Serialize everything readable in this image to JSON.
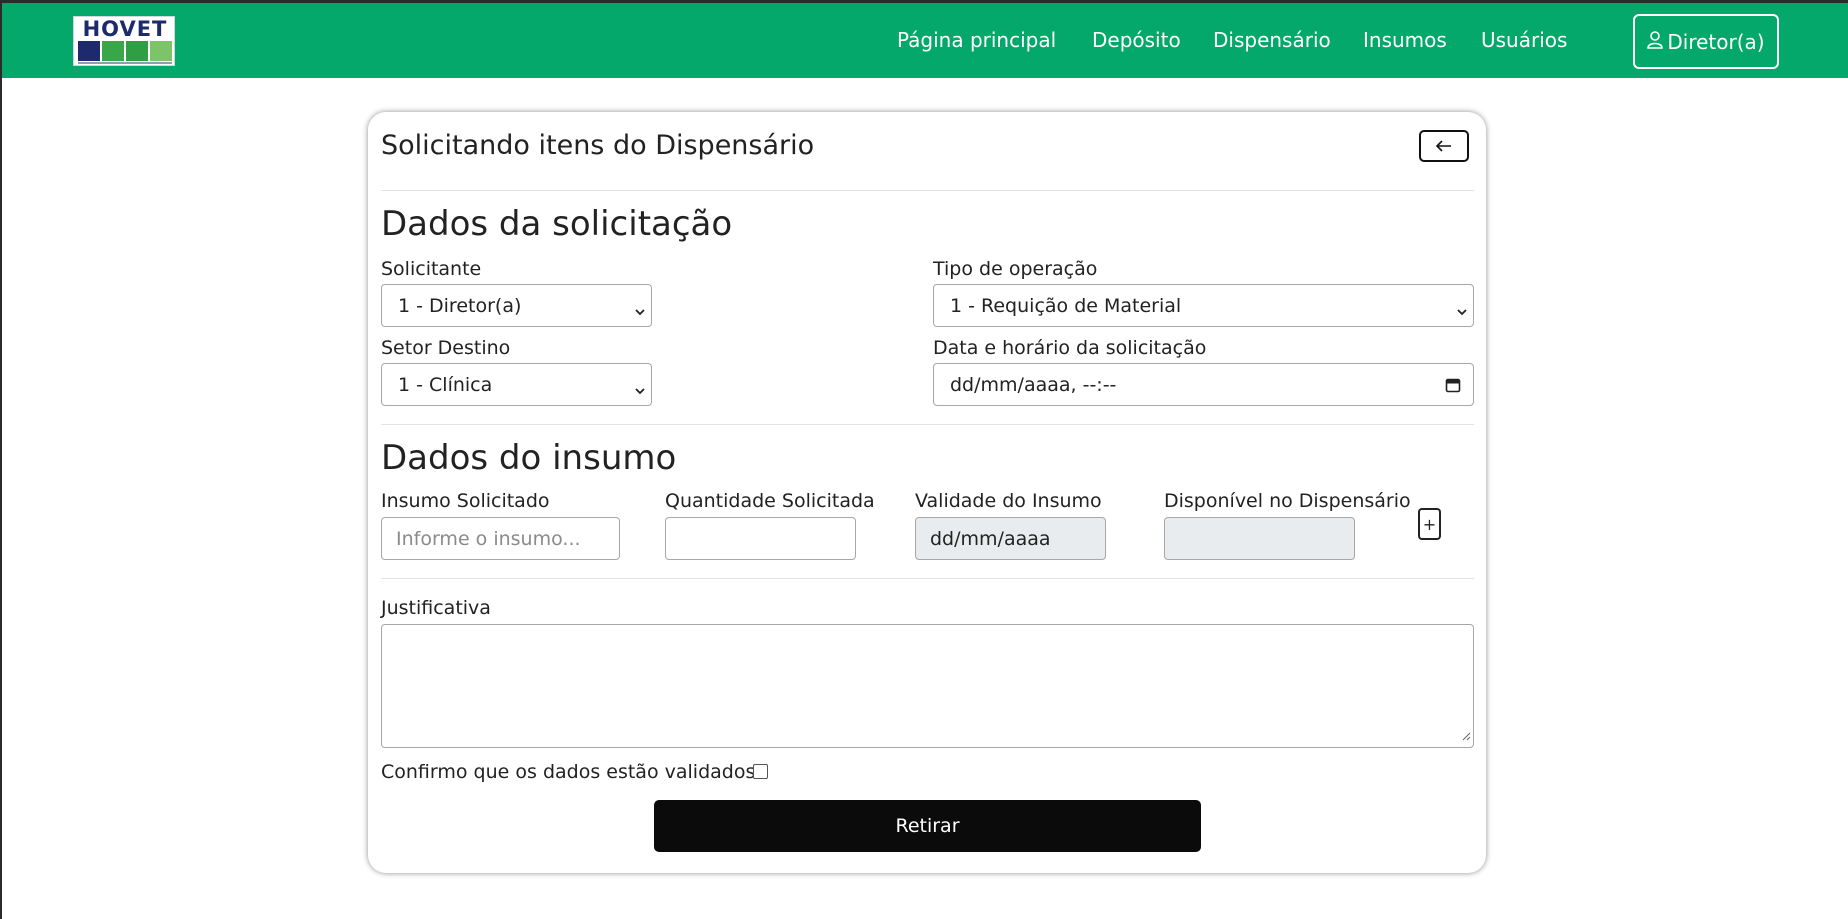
{
  "brand": {
    "name": "HOVET"
  },
  "nav": {
    "links": [
      "Página principal",
      "Depósito",
      "Dispensário",
      "Insumos",
      "Usuários"
    ],
    "user_label": "Diretor(a)"
  },
  "card": {
    "title": "Solicitando itens do Dispensário",
    "section_request": "Dados da solicitação",
    "solicitante": {
      "label": "Solicitante",
      "value": "1 - Diretor(a)"
    },
    "tipo_operacao": {
      "label": "Tipo de operação",
      "value": "1 - Requição de Material"
    },
    "setor_destino": {
      "label": "Setor Destino",
      "value": "1 - Clínica"
    },
    "data_horario": {
      "label": "Data e horário da solicitação",
      "value": "dd/mm/aaaa, --:--"
    },
    "section_item": "Dados do insumo",
    "insumo": {
      "label": "Insumo Solicitado",
      "placeholder": "Informe o insumo..."
    },
    "quantidade": {
      "label": "Quantidade Solicitada",
      "value": ""
    },
    "validade": {
      "label": "Validade do Insumo",
      "value": "dd/mm/aaaa"
    },
    "disponivel": {
      "label": "Disponível no Dispensário",
      "value": ""
    },
    "add_label": "+",
    "justificativa": {
      "label": "Justificativa",
      "value": ""
    },
    "confirm_label": "Confirmo que os dados estão validados",
    "confirm_checked": false,
    "submit_label": "Retirar"
  },
  "colors": {
    "navbar": "#05a86b",
    "submit": "#0b0b0b",
    "disabled_field": "#e9ecef"
  }
}
